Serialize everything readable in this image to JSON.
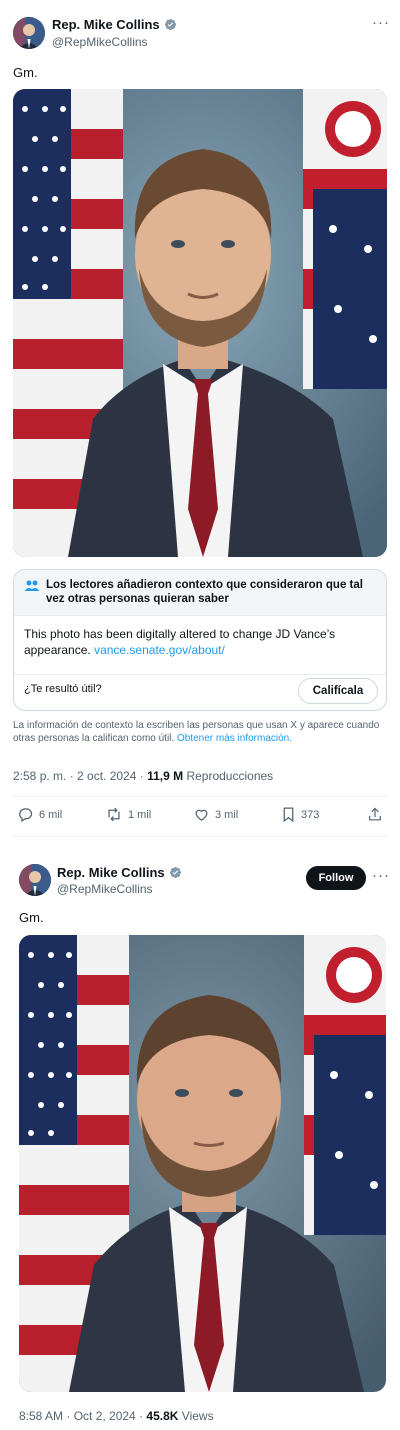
{
  "tweet1": {
    "author_name": "Rep. Mike Collins",
    "author_handle": "@RepMikeCollins",
    "text": "Gm.",
    "note": {
      "title": "Los lectores añadieron contexto que consideraron que tal vez otras personas quieran saber",
      "body": "This photo has been digitally altered to change JD Vance’s appearance.",
      "link": "vance.senate.gov/about/",
      "question": "¿Te resultó útil?",
      "rate_label": "Califícala",
      "footer_text": "La información de contexto la escriben las personas que usan X y aparece cuando otras personas la califican como útil.",
      "footer_link": "Obtener más información."
    },
    "timestamp": "2:58 p. m. · 2 oct. 2024 ·",
    "views_count": "11,9 M",
    "views_label": "Reproducciones",
    "actions": {
      "replies": "6 mil",
      "reposts": "1 mil",
      "likes": "3 mil",
      "bookmarks": "373"
    }
  },
  "tweet2": {
    "author_name": "Rep. Mike Collins",
    "author_handle": "@RepMikeCollins",
    "follow_label": "Follow",
    "text": "Gm.",
    "timestamp": "8:58 AM · Oct 2, 2024 ·",
    "views_count": "45.8K",
    "views_label": "Views"
  },
  "icons": {
    "verified": "verified-badge-icon",
    "more": "more-icon",
    "reply": "reply-icon",
    "repost": "repost-icon",
    "like": "like-icon",
    "bookmark": "bookmark-icon",
    "share": "share-icon",
    "people": "people-icon"
  },
  "colors": {
    "accent": "#1d9bf0",
    "text_primary": "#0f1419",
    "text_secondary": "#536471",
    "verified": "#829aab"
  }
}
